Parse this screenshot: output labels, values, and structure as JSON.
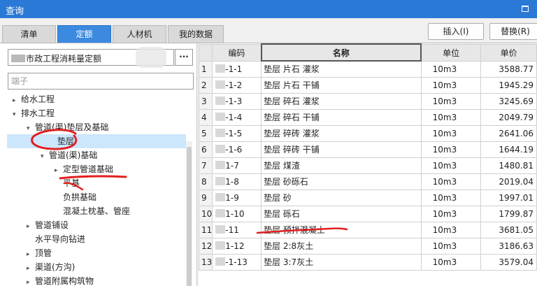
{
  "window": {
    "title": "查询"
  },
  "tabs": [
    {
      "label": "清单",
      "active": false
    },
    {
      "label": "定额",
      "active": true
    },
    {
      "label": "人材机",
      "active": false
    },
    {
      "label": "我的数据",
      "active": false
    }
  ],
  "toolbar": {
    "insert_label": "插入(I)",
    "replace_label": "替换(R)"
  },
  "library": {
    "name_suffix": "市政工程消耗量定额",
    "browse_label": "···"
  },
  "filter": {
    "placeholder": "端子"
  },
  "tree": [
    {
      "label": "给水工程",
      "level": 0,
      "arrow": "▸",
      "selected": false
    },
    {
      "label": "排水工程",
      "level": 0,
      "arrow": "▾",
      "selected": false
    },
    {
      "label": "管道(渠)垫层及基础",
      "level": 1,
      "arrow": "▾",
      "selected": false
    },
    {
      "label": "垫层",
      "level": 2,
      "arrow": "",
      "selected": true
    },
    {
      "label": "管道(渠)基础",
      "level": 2,
      "arrow": "▾",
      "selected": false
    },
    {
      "label": "定型管道基础",
      "level": 3,
      "arrow": "▸",
      "selected": false
    },
    {
      "label": "平基",
      "level": 3,
      "arrow": "",
      "selected": false
    },
    {
      "label": "负拱基础",
      "level": 3,
      "arrow": "",
      "selected": false
    },
    {
      "label": "混凝土枕基、管座",
      "level": 3,
      "arrow": "",
      "selected": false
    },
    {
      "label": "管道铺设",
      "level": 1,
      "arrow": "▸",
      "selected": false
    },
    {
      "label": "水平导向钻进",
      "level": 1,
      "arrow": "",
      "selected": false
    },
    {
      "label": "顶管",
      "level": 1,
      "arrow": "▸",
      "selected": false
    },
    {
      "label": "渠道(方沟)",
      "level": 1,
      "arrow": "▸",
      "selected": false
    },
    {
      "label": "管道附属构筑物",
      "level": 1,
      "arrow": "▸",
      "selected": false
    }
  ],
  "table": {
    "headers": {
      "code": "编码",
      "name": "名称",
      "unit": "单位",
      "price": "单价"
    },
    "rows": [
      {
        "rn": "1",
        "code": "-1-1",
        "name": "垫层 片石 灌浆",
        "unit": "10m3",
        "price": "3588.77"
      },
      {
        "rn": "2",
        "code": "-1-2",
        "name": "垫层 片石 干铺",
        "unit": "10m3",
        "price": "1945.29"
      },
      {
        "rn": "3",
        "code": "-1-3",
        "name": "垫层 碎石 灌浆",
        "unit": "10m3",
        "price": "3245.69"
      },
      {
        "rn": "4",
        "code": "-1-4",
        "name": "垫层 碎石 干铺",
        "unit": "10m3",
        "price": "2049.79"
      },
      {
        "rn": "5",
        "code": "-1-5",
        "name": "垫层 碎砖 灌浆",
        "unit": "10m3",
        "price": "2641.06"
      },
      {
        "rn": "6",
        "code": "-1-6",
        "name": "垫层 碎砖 干铺",
        "unit": "10m3",
        "price": "1644.19"
      },
      {
        "rn": "7",
        "code": "1-7",
        "name": "垫层 煤渣",
        "unit": "10m3",
        "price": "1480.81"
      },
      {
        "rn": "8",
        "code": "1-8",
        "name": "垫层 砂砾石",
        "unit": "10m3",
        "price": "2019.04"
      },
      {
        "rn": "9",
        "code": "1-9",
        "name": "垫层 砂",
        "unit": "10m3",
        "price": "1997.01"
      },
      {
        "rn": "10",
        "code": "1-10",
        "name": "垫层 砾石",
        "unit": "10m3",
        "price": "1799.87"
      },
      {
        "rn": "11",
        "code": "-11",
        "name": "垫层 预拌混凝土",
        "unit": "10m3",
        "price": "3681.05"
      },
      {
        "rn": "12",
        "code": "1-12",
        "name": "垫层 2:8灰土",
        "unit": "10m3",
        "price": "3186.63"
      },
      {
        "rn": "13",
        "code": "-1-13",
        "name": "垫层 3:7灰土",
        "unit": "10m3",
        "price": "3579.04"
      }
    ]
  },
  "colors": {
    "titlebar": "#2b79d6",
    "active_tab": "#3c8ae0",
    "selection": "#cce6fb",
    "annotation": "#e02020"
  }
}
